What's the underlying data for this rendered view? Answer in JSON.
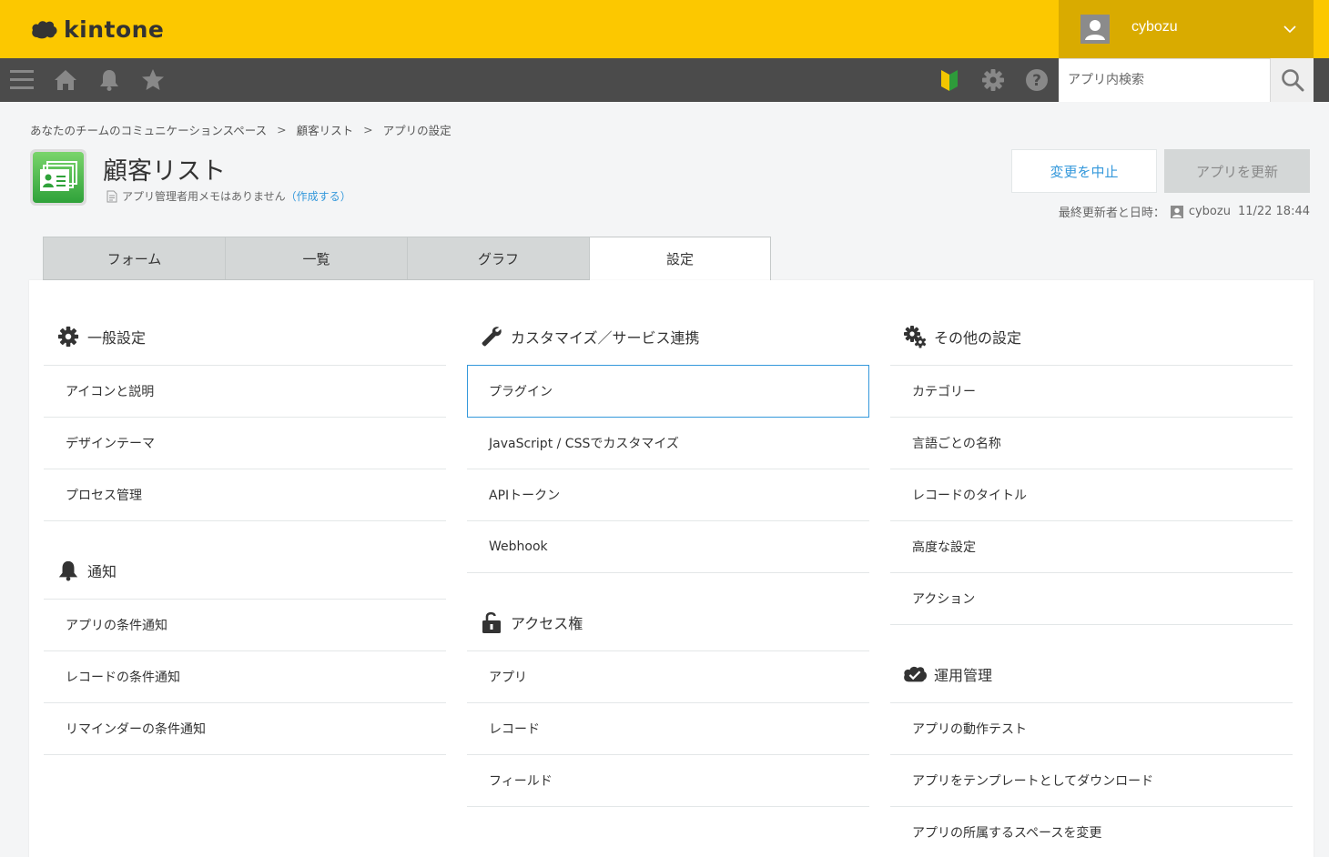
{
  "brand": {
    "logo_text": "kintone",
    "accent": "#fcc800"
  },
  "user": {
    "name": "cybozu"
  },
  "toolbar": {
    "icons": [
      "menu-icon",
      "home-icon",
      "bell-icon",
      "star-icon",
      "beginner-mark-icon",
      "gear-icon",
      "help-icon"
    ],
    "search_placeholder": "アプリ内検索"
  },
  "breadcrumb": [
    "あなたのチームのコミュニケーションスペース",
    "顧客リスト",
    "アプリの設定"
  ],
  "breadcrumb_sep": ">",
  "app": {
    "title": "顧客リスト",
    "memo_text": "アプリ管理者用メモはありません",
    "memo_link_open": "（",
    "memo_link": "作成する",
    "memo_link_close": "）"
  },
  "actions": {
    "cancel": "変更を中止",
    "update": "アプリを更新"
  },
  "last_updated": {
    "label": "最終更新者と日時：",
    "user": "cybozu",
    "datetime": "11/22 18:44"
  },
  "tabs": [
    "フォーム",
    "一覧",
    "グラフ",
    "設定"
  ],
  "active_tab": "設定",
  "columns": {
    "left": {
      "general": {
        "title": "一般設定",
        "items": [
          "アイコンと説明",
          "デザインテーマ",
          "プロセス管理"
        ]
      },
      "notify": {
        "title": "通知",
        "items": [
          "アプリの条件通知",
          "レコードの条件通知",
          "リマインダーの条件通知"
        ]
      }
    },
    "middle": {
      "customize": {
        "title": "カスタマイズ／サービス連携",
        "items": [
          "プラグイン",
          "JavaScript / CSSでカスタマイズ",
          "APIトークン",
          "Webhook"
        ]
      },
      "access": {
        "title": "アクセス権",
        "items": [
          "アプリ",
          "レコード",
          "フィールド"
        ]
      }
    },
    "right": {
      "other": {
        "title": "その他の設定",
        "items": [
          "カテゴリー",
          "言語ごとの名称",
          "レコードのタイトル",
          "高度な設定",
          "アクション"
        ]
      },
      "ops": {
        "title": "運用管理",
        "items": [
          "アプリの動作テスト",
          "アプリをテンプレートとしてダウンロード",
          "アプリの所属するスペースを変更"
        ]
      }
    }
  }
}
